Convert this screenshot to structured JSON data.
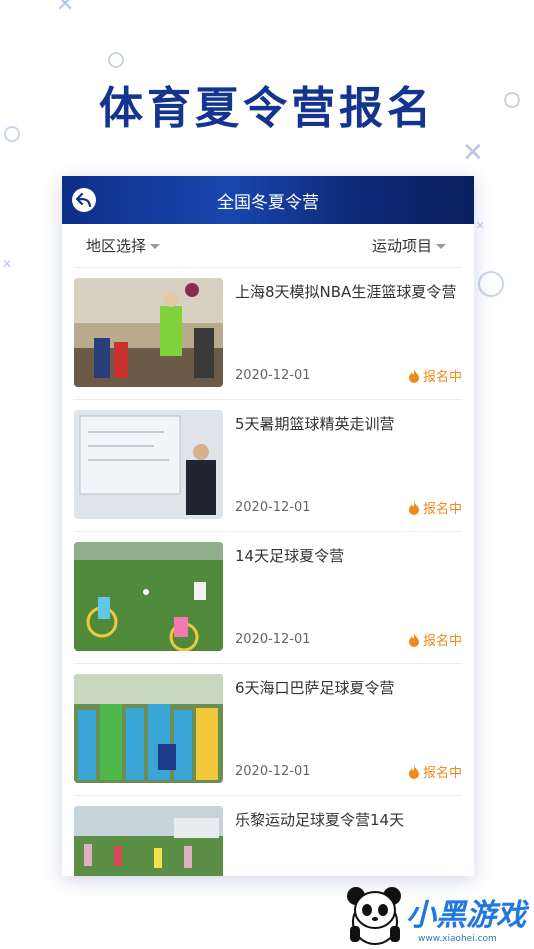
{
  "headline": "体育夏令营报名",
  "topbar": {
    "title": "全国冬夏令营",
    "back_icon": "back-arrow-icon"
  },
  "filters": {
    "region": "地区选择",
    "sport": "运动项目"
  },
  "items": [
    {
      "title": "上海8天模拟NBA生涯篮球夏令营",
      "date": "2020-12-01",
      "status": "报名中"
    },
    {
      "title": "5天暑期篮球精英走训营",
      "date": "2020-12-01",
      "status": "报名中"
    },
    {
      "title": "14天足球夏令营",
      "date": "2020-12-01",
      "status": "报名中"
    },
    {
      "title": "6天海口巴萨足球夏令营",
      "date": "2020-12-01",
      "status": "报名中"
    },
    {
      "title": "乐黎运动足球夏令营14天",
      "date": "",
      "status": ""
    }
  ],
  "watermark": {
    "brand": "小黑游戏",
    "url": "www.xiaohei.com"
  },
  "colors": {
    "headline": "#13348f",
    "status": "#f08a1c",
    "topbar": "#0d2f88"
  }
}
